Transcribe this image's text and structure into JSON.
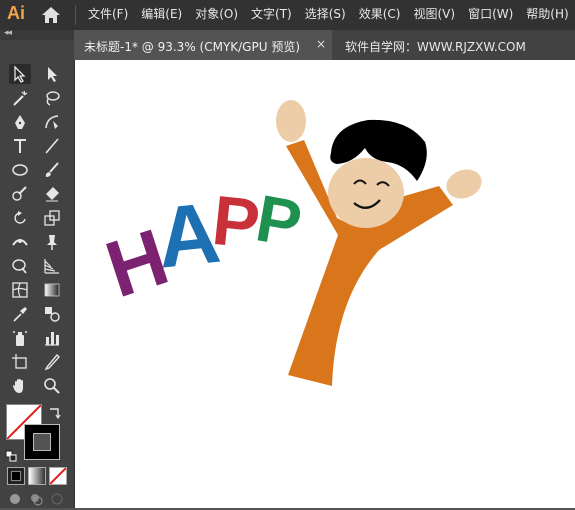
{
  "app": {
    "logo_text": "Ai",
    "logo_color": "#f0a44b"
  },
  "menu": [
    "文件(F)",
    "编辑(E)",
    "对象(O)",
    "文字(T)",
    "选择(S)",
    "效果(C)",
    "视图(V)",
    "窗口(W)",
    "帮助(H)"
  ],
  "toolbar": {
    "collapse_label": "◂◂"
  },
  "tabs": {
    "active_label": "未标题-1* @ 93.3% (CMYK/GPU 预览)",
    "close_label": "×",
    "second_label": "软件自学网：WWW.RJZXW.COM"
  },
  "artwork": {
    "letters": [
      {
        "char": "H",
        "color": "#7b2270"
      },
      {
        "char": "A",
        "color": "#1d70b1"
      },
      {
        "char": "P",
        "color": "#c8313a"
      },
      {
        "char": "P",
        "color": "#1e9150"
      }
    ],
    "body_color": "#d9761b",
    "skin_color": "#edcca8",
    "hair_color": "#000000"
  }
}
